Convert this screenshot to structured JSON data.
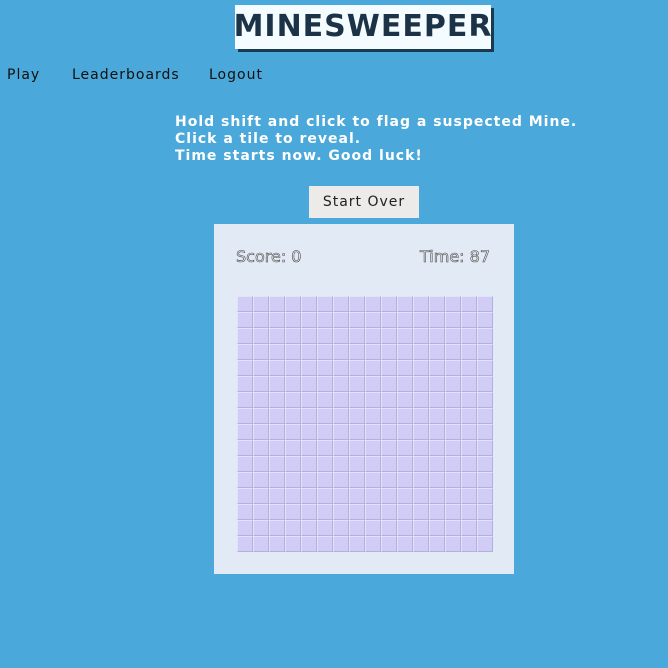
{
  "app": {
    "title": "MINESWEEPER"
  },
  "nav": {
    "items": [
      {
        "label": "Play"
      },
      {
        "label": "Leaderboards"
      },
      {
        "label": "Logout"
      }
    ]
  },
  "instructions": {
    "lines": [
      "Hold shift and click to flag a suspected Mine.",
      "Click a tile to reveal.",
      "Time starts now. Good luck!"
    ]
  },
  "controls": {
    "start_over_label": "Start Over"
  },
  "game": {
    "score_text": "Score: 0",
    "time_text": "Time: 87",
    "score": 0,
    "time": 87,
    "rows": 16,
    "cols": 16,
    "tile_state": "unrevealed"
  },
  "colors": {
    "background": "#4aa8da",
    "panel": "#e2ebf5",
    "tile": "#d0ccf6",
    "title_text": "#1c3347"
  }
}
